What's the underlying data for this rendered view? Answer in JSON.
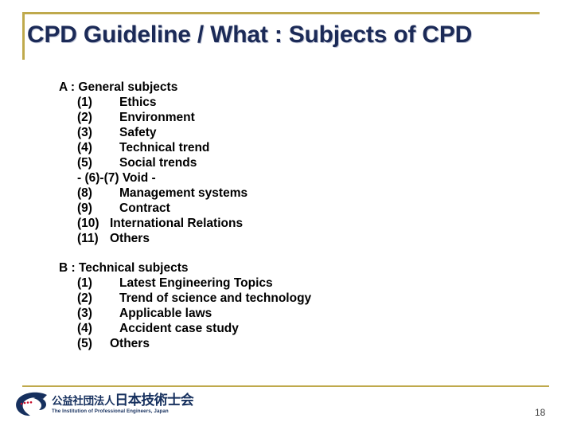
{
  "title": "CPD Guideline / What : Subjects of CPD",
  "colors": {
    "title_text": "#1B2A57",
    "rule_gold": "#BFA94C",
    "logo_blue": "#16305E",
    "logo_accent_red": "#C8102E",
    "body_text": "#000000",
    "background": "#FFFFFF"
  },
  "body": {
    "groups": [
      {
        "heading": "A : General subjects",
        "items": [
          {
            "num": "(1)",
            "label": "Ethics"
          },
          {
            "num": "(2)",
            "label": "Environment"
          },
          {
            "num": "(3)",
            "label": "Safety"
          },
          {
            "num": "(4)",
            "label": "Technical trend"
          },
          {
            "num": "(5)",
            "label": "Social trends"
          }
        ],
        "note": "- (6)-(7) Void -",
        "items_after_note": [
          {
            "num": "(8)",
            "label": "Management systems"
          },
          {
            "num": "(9)",
            "label": "Contract"
          },
          {
            "num": "(10)",
            "label": "International Relations"
          },
          {
            "num": "(11)",
            "label": "Others"
          }
        ]
      },
      {
        "heading": "B : Technical subjects",
        "items": [
          {
            "num": "(1)",
            "label": "Latest Engineering Topics"
          },
          {
            "num": "(2)",
            "label": "Trend of science and technology"
          },
          {
            "num": "(3)",
            "label": "Applicable laws"
          },
          {
            "num": "(4)",
            "label": "Accident case study"
          },
          {
            "num": "(5)",
            "label": "Others"
          }
        ]
      }
    ]
  },
  "footer": {
    "logo": {
      "icon": "ipej-swoosh-logo",
      "jp_prefix": "公益社団法人",
      "jp_main": "日本技術士会",
      "en": "The Institution of Professional Engineers, Japan"
    },
    "page_number": "18"
  }
}
